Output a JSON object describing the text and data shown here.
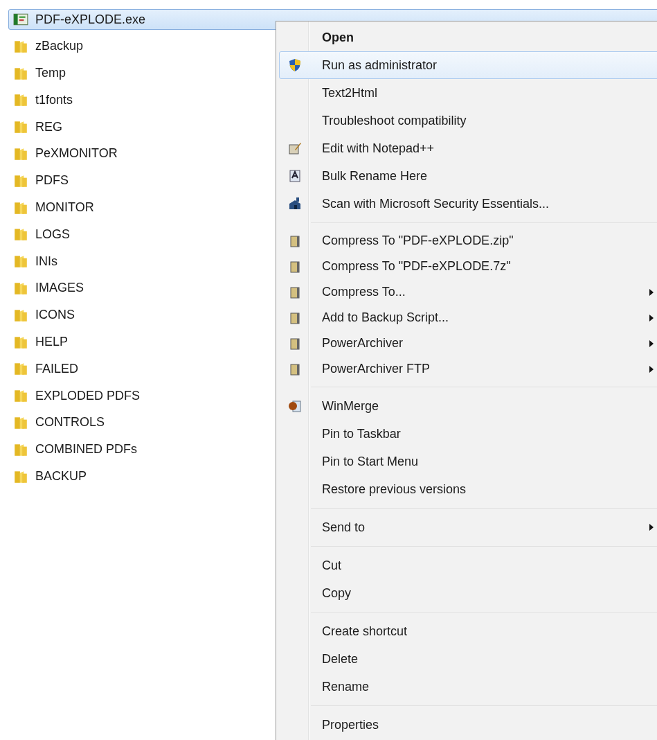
{
  "files": [
    {
      "name": "PDF-eXPLODE.exe",
      "kind": "app",
      "selected": true
    },
    {
      "name": "zBackup",
      "kind": "folder",
      "selected": false
    },
    {
      "name": "Temp",
      "kind": "folder",
      "selected": false
    },
    {
      "name": "t1fonts",
      "kind": "folder",
      "selected": false
    },
    {
      "name": "REG",
      "kind": "folder",
      "selected": false
    },
    {
      "name": "PeXMONITOR",
      "kind": "folder",
      "selected": false
    },
    {
      "name": "PDFS",
      "kind": "folder",
      "selected": false
    },
    {
      "name": "MONITOR",
      "kind": "folder",
      "selected": false
    },
    {
      "name": "LOGS",
      "kind": "folder",
      "selected": false
    },
    {
      "name": "INIs",
      "kind": "folder",
      "selected": false
    },
    {
      "name": "IMAGES",
      "kind": "folder",
      "selected": false
    },
    {
      "name": "ICONS",
      "kind": "folder",
      "selected": false
    },
    {
      "name": "HELP",
      "kind": "folder",
      "selected": false
    },
    {
      "name": "FAILED",
      "kind": "folder",
      "selected": false
    },
    {
      "name": "EXPLODED PDFS",
      "kind": "folder",
      "selected": false
    },
    {
      "name": "CONTROLS",
      "kind": "folder",
      "selected": false
    },
    {
      "name": "COMBINED PDFs",
      "kind": "folder",
      "selected": false
    },
    {
      "name": "BACKUP",
      "kind": "folder",
      "selected": false
    }
  ],
  "context_menu": {
    "items": [
      {
        "kind": "plain",
        "label": "Open",
        "default": true,
        "selected": false
      },
      {
        "kind": "shield",
        "label": "Run as administrator",
        "selected": true
      },
      {
        "kind": "plain",
        "label": "Text2Html",
        "selected": false
      },
      {
        "kind": "plain",
        "label": "Troubleshoot compatibility",
        "selected": false
      },
      {
        "kind": "notepad",
        "label": "Edit with Notepad++",
        "selected": false
      },
      {
        "kind": "rename",
        "label": "Bulk Rename Here",
        "selected": false
      },
      {
        "kind": "scan",
        "label": "Scan with Microsoft Security Essentials...",
        "selected": false
      },
      {
        "kind": "separator"
      },
      {
        "kind": "archive",
        "label": "Compress To \"PDF-eXPLODE.zip\"",
        "selected": false
      },
      {
        "kind": "archive",
        "label": "Compress To \"PDF-eXPLODE.7z\"",
        "selected": false
      },
      {
        "kind": "archive",
        "label": "Compress To...",
        "submenu": true,
        "selected": false
      },
      {
        "kind": "archive",
        "label": "Add to Backup Script...",
        "submenu": true,
        "selected": false
      },
      {
        "kind": "archive",
        "label": "PowerArchiver",
        "submenu": true,
        "selected": false
      },
      {
        "kind": "archive",
        "label": "PowerArchiver FTP",
        "submenu": true,
        "selected": false
      },
      {
        "kind": "separator"
      },
      {
        "kind": "merge",
        "label": "WinMerge",
        "selected": false
      },
      {
        "kind": "plain",
        "label": "Pin to Taskbar",
        "selected": false
      },
      {
        "kind": "plain",
        "label": "Pin to Start Menu",
        "selected": false
      },
      {
        "kind": "plain",
        "label": "Restore previous versions",
        "selected": false
      },
      {
        "kind": "separator"
      },
      {
        "kind": "plain",
        "label": "Send to",
        "submenu": true,
        "selected": false
      },
      {
        "kind": "separator"
      },
      {
        "kind": "plain",
        "label": "Cut",
        "selected": false
      },
      {
        "kind": "plain",
        "label": "Copy",
        "selected": false
      },
      {
        "kind": "separator"
      },
      {
        "kind": "plain",
        "label": "Create shortcut",
        "selected": false
      },
      {
        "kind": "plain",
        "label": "Delete",
        "selected": false
      },
      {
        "kind": "plain",
        "label": "Rename",
        "selected": false
      },
      {
        "kind": "separator"
      },
      {
        "kind": "plain",
        "label": "Properties",
        "selected": false
      }
    ]
  }
}
